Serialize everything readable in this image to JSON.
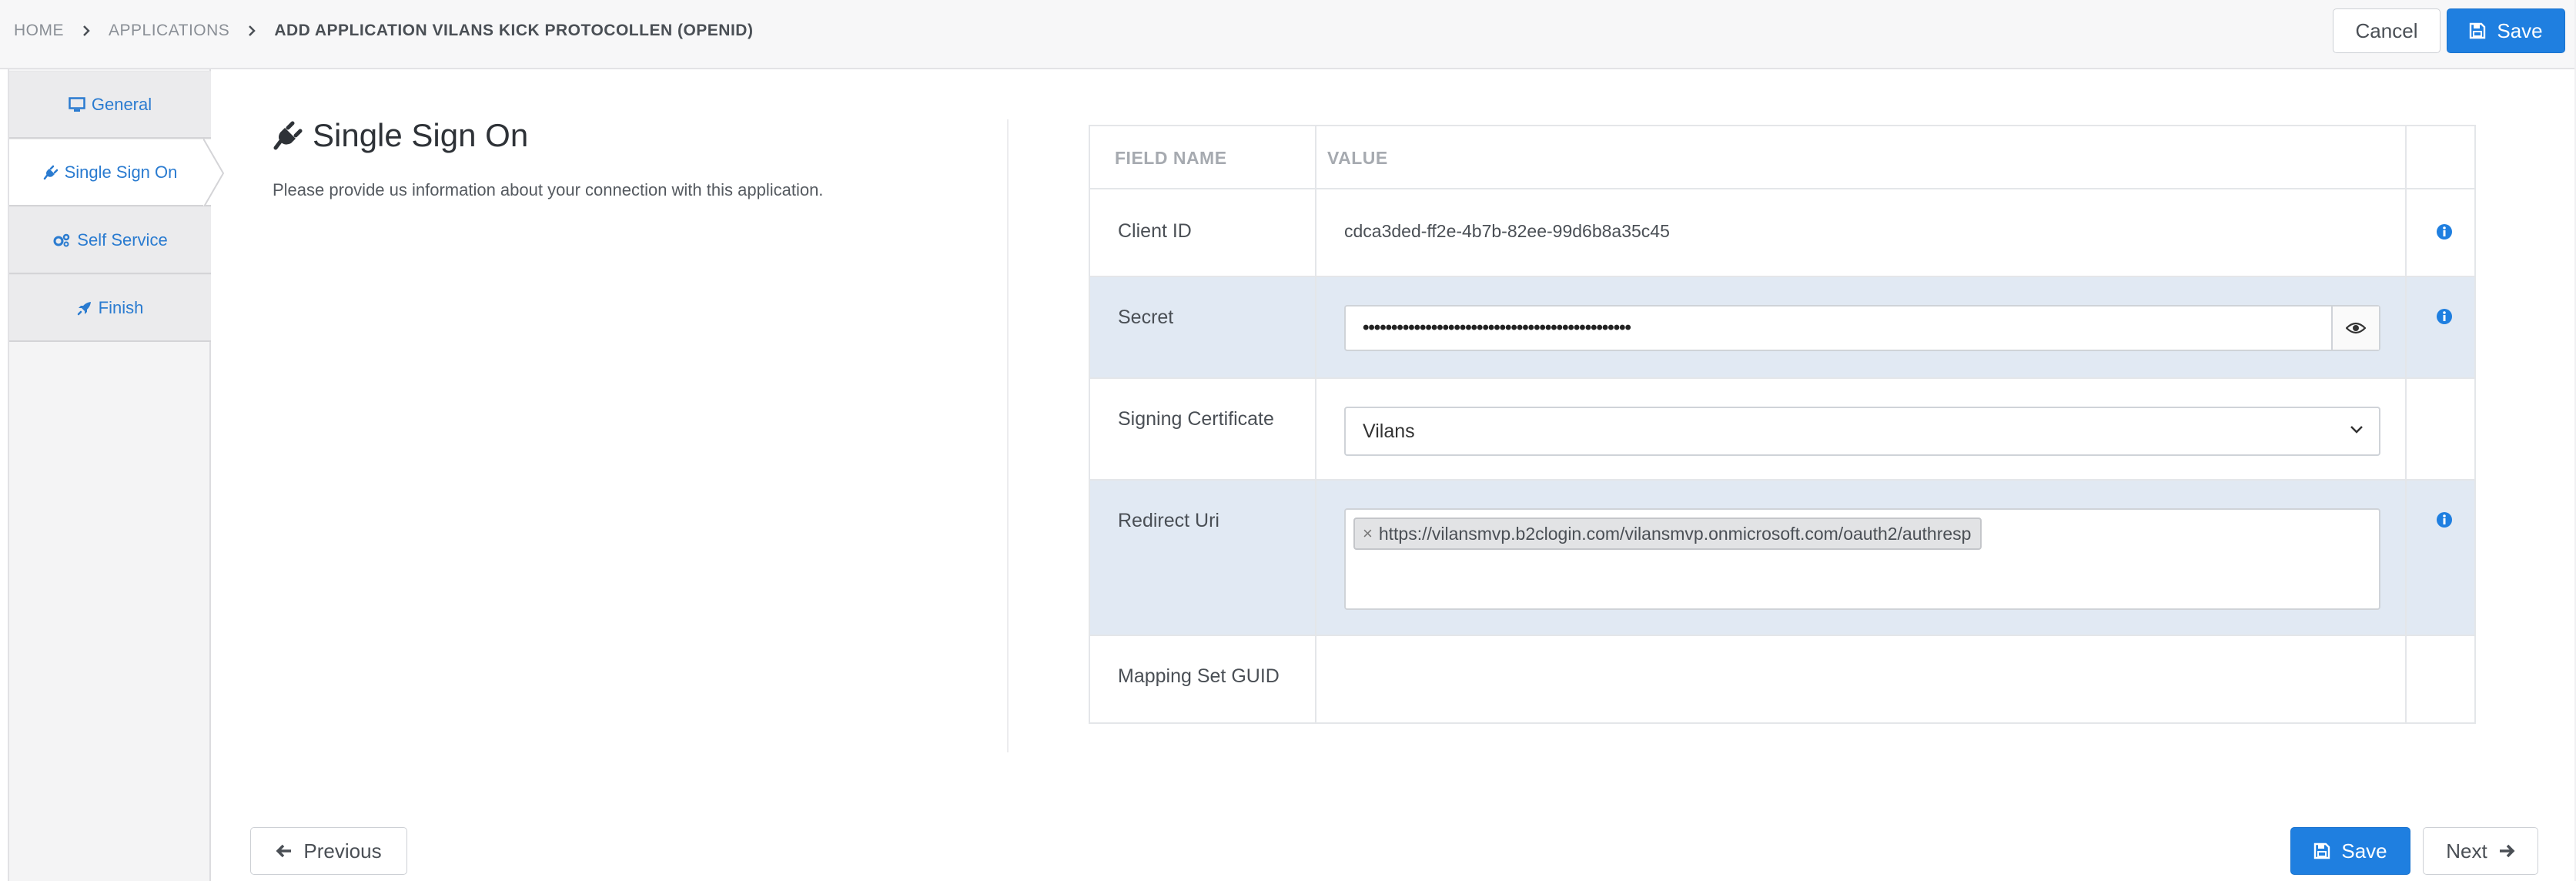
{
  "breadcrumb": {
    "home": "HOME",
    "applications": "APPLICATIONS",
    "current": "ADD APPLICATION VILANS KICK PROTOCOLLEN (OPENID)"
  },
  "header_actions": {
    "cancel": "Cancel",
    "save": "Save"
  },
  "steps": [
    {
      "label": "General",
      "icon": "monitor-icon",
      "active": false
    },
    {
      "label": "Single Sign On",
      "icon": "plug-icon",
      "active": true
    },
    {
      "label": "Self Service",
      "icon": "gears-icon",
      "active": false
    },
    {
      "label": "Finish",
      "icon": "rocket-icon",
      "active": false
    }
  ],
  "section": {
    "title": "Single Sign On",
    "icon": "plug-icon",
    "description": "Please provide us information about your connection with this application."
  },
  "table": {
    "headers": {
      "field": "FIELD NAME",
      "value": "VALUE"
    },
    "client_id": {
      "label": "Client ID",
      "value": "cdca3ded-ff2e-4b7b-82ee-99d6b8a35c45"
    },
    "secret": {
      "label": "Secret",
      "masked_value": "•••••••••••••••••••••••••••••••••••••••••••••••"
    },
    "signing_certificate": {
      "label": "Signing Certificate",
      "selected": "Vilans"
    },
    "redirect_uri": {
      "label": "Redirect Uri",
      "tags": [
        "https://vilansmvp.b2clogin.com/vilansmvp.onmicrosoft.com/oauth2/authresp"
      ],
      "remove_symbol": "×"
    },
    "mapping_set_guid": {
      "label": "Mapping Set GUID",
      "value": ""
    }
  },
  "footer": {
    "previous": "Previous",
    "save": "Save",
    "next": "Next"
  },
  "colors": {
    "primary": "#1f7fe0",
    "link": "#2a7bd0",
    "alt_row": "#e1e9f3",
    "header_bg": "#f7f7f8"
  }
}
